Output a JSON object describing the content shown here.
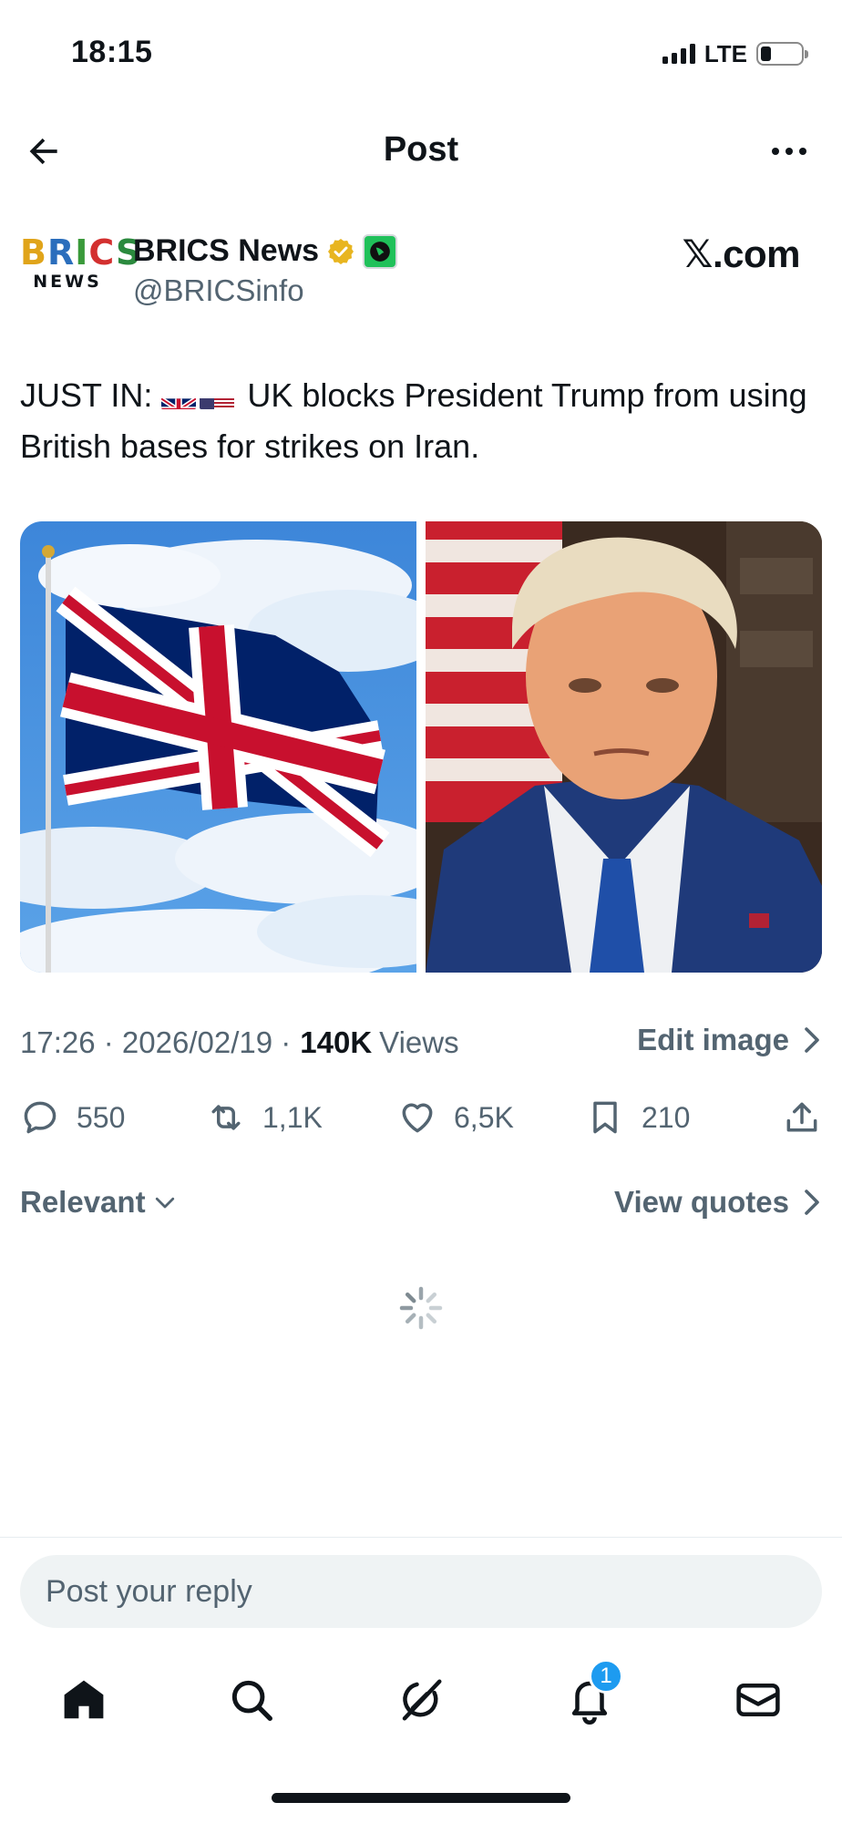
{
  "status_bar": {
    "time": "18:15",
    "network": "LTE",
    "battery_level": 0.2
  },
  "header": {
    "title": "Post",
    "back_icon": "arrow-left-icon",
    "more_icon": "more-dots-icon"
  },
  "author": {
    "avatar_text_top": "BRICS",
    "avatar_text_bottom": "NEWS",
    "name": "BRICS News",
    "handle": "@BRICSinfo",
    "verified": true,
    "source_link": "𝕏.com"
  },
  "post": {
    "text_prefix": "JUST IN:",
    "flags": [
      "uk-flag",
      "us-flag"
    ],
    "text_body": "UK blocks President Trump from using British bases for strikes on Iran.",
    "images": [
      "union-jack-flag-photo",
      "trump-portrait-photo"
    ]
  },
  "meta": {
    "time": "17:26",
    "date": "2026/02/19",
    "views_count": "140K",
    "views_label": "Views",
    "edit_image_label": "Edit image"
  },
  "actions": {
    "replies": "550",
    "reposts": "1,1K",
    "likes": "6,5K",
    "bookmarks": "210"
  },
  "filter": {
    "sort_label": "Relevant",
    "view_quotes_label": "View quotes"
  },
  "reply": {
    "placeholder": "Post your reply"
  },
  "tabs": {
    "items": [
      "home",
      "search",
      "grok",
      "notifications",
      "messages"
    ],
    "notifications_badge": "1"
  },
  "colors": {
    "text": "#0f1419",
    "secondary": "#536471",
    "accent": "#1d9bf0",
    "verified": "#e8b520"
  }
}
